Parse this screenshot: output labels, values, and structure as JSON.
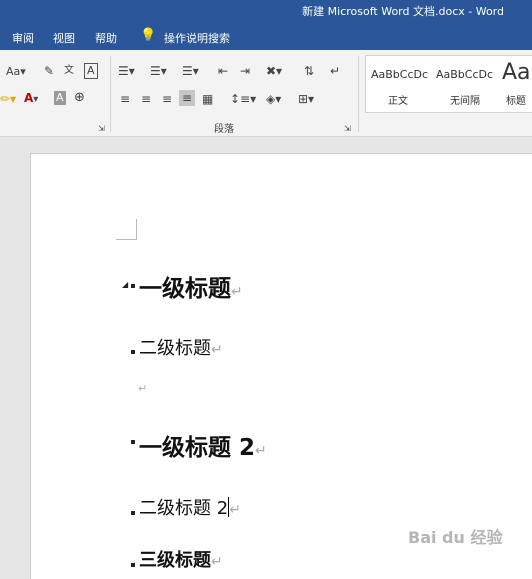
{
  "window": {
    "title": "新建 Microsoft Word 文档.docx  -  Word"
  },
  "menu": {
    "items": [
      "审阅",
      "视图",
      "帮助"
    ],
    "search_label": "操作说明搜索"
  },
  "ribbon": {
    "font_size_label": "Aa",
    "paragraph_group_label": "段落",
    "styles": [
      {
        "preview": "AaBbCcDc",
        "label": "正文"
      },
      {
        "preview": "AaBbCcDc",
        "label": "无间隔"
      },
      {
        "preview": "Aa",
        "label": "标题"
      }
    ]
  },
  "document": {
    "paragraphs": [
      {
        "level": 1,
        "text": "一级标题"
      },
      {
        "level": 2,
        "text": "二级标题"
      },
      {
        "level": 0,
        "text": ""
      },
      {
        "level": 1,
        "text": "一级标题 2"
      },
      {
        "level": 2,
        "text": "二级标题 2"
      },
      {
        "level": 3,
        "text": "三级标题"
      }
    ],
    "paragraph_mark": "↵"
  },
  "watermark": {
    "text": "Bai du 经验"
  }
}
